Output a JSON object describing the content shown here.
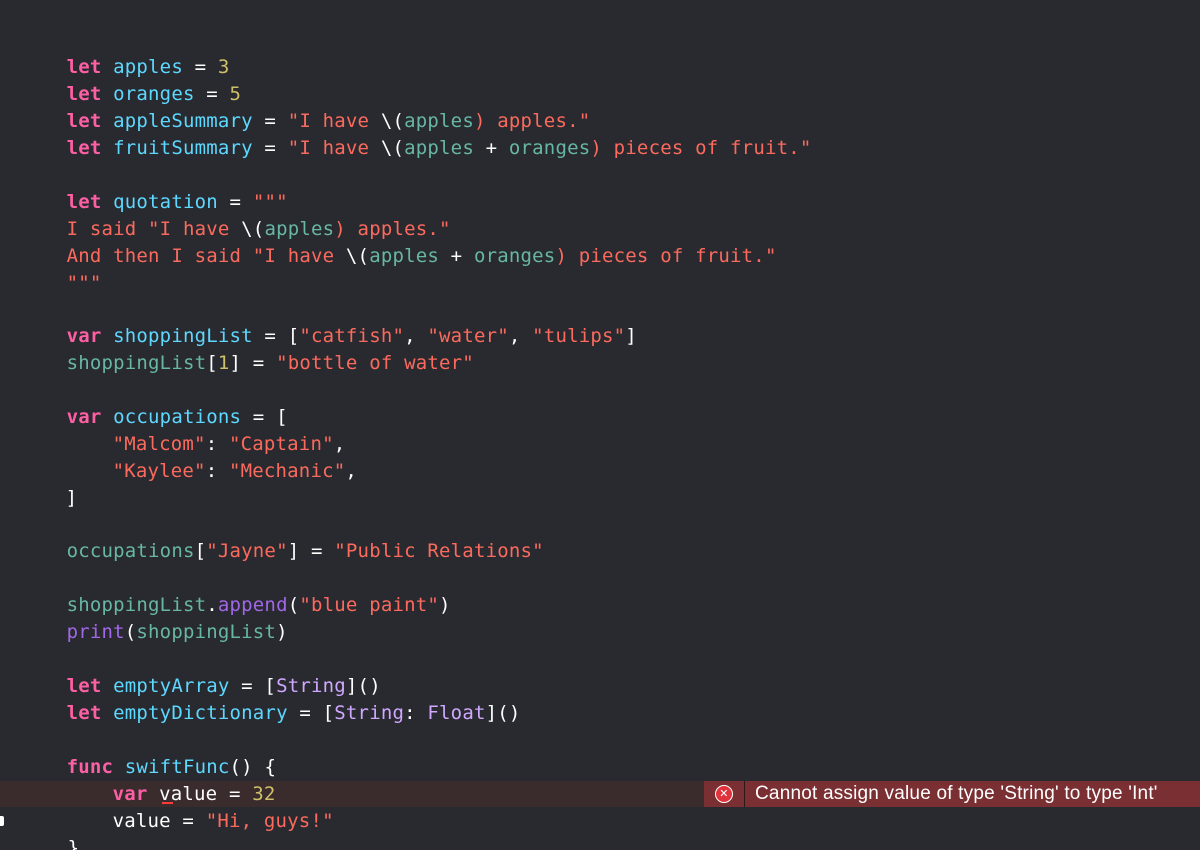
{
  "editor": {
    "lines": {
      "l1": [
        "let",
        "apples",
        " = ",
        "3"
      ],
      "l2": [
        "let",
        "oranges",
        " = ",
        "5"
      ],
      "l3": [
        "let",
        "appleSummary",
        " = ",
        "\"I have ",
        "\\(",
        "apples",
        ") apples.\""
      ],
      "l4": [
        "let",
        "fruitSummary",
        " = ",
        "\"I have ",
        "\\(",
        "apples",
        " + ",
        "oranges",
        ") pieces of fruit.\""
      ],
      "l5": [
        "let",
        "quotation",
        " = ",
        "\"\"\""
      ],
      "l6": [
        "I said \"I have ",
        "\\(",
        "apples",
        ") apples.\""
      ],
      "l7": [
        "And then I said \"I have ",
        "\\(",
        "apples",
        " + ",
        "oranges",
        ") pieces of fruit.\""
      ],
      "l8": [
        "\"\"\""
      ],
      "l9": [
        "var",
        "shoppingList",
        " = [",
        "\"catfish\"",
        ", ",
        "\"water\"",
        ", ",
        "\"tulips\"",
        "]"
      ],
      "l10": [
        "shoppingList",
        "[",
        "1",
        "] = ",
        "\"bottle of water\""
      ],
      "l11": [
        "var",
        "occupations",
        " = ["
      ],
      "l12": [
        "\"Malcom\"",
        ": ",
        "\"Captain\"",
        ","
      ],
      "l13": [
        "\"Kaylee\"",
        ": ",
        "\"Mechanic\"",
        ","
      ],
      "l14": [
        "]"
      ],
      "l15": [
        "occupations",
        "[",
        "\"Jayne\"",
        "] = ",
        "\"Public Relations\""
      ],
      "l16": [
        "shoppingList",
        ".",
        "append",
        "(",
        "\"blue paint\"",
        ")"
      ],
      "l17": [
        "print",
        "(",
        "shoppingList",
        ")"
      ],
      "l18": [
        "let",
        "emptyArray",
        " = [",
        "String",
        "]()"
      ],
      "l19": [
        "let",
        "emptyDictionary",
        " = [",
        "String",
        ": ",
        "Float",
        "]()"
      ],
      "l20": [
        "func",
        "swiftFunc",
        "() {"
      ],
      "l21": [
        "var",
        "value",
        " = ",
        "32"
      ],
      "l22": [
        "value = ",
        "\"Hi, guys!\""
      ],
      "l23": [
        "}"
      ]
    }
  },
  "error": {
    "icon": "error-x-icon",
    "glyph": "✕",
    "message": "Cannot assign value of type 'String' to type 'Int'"
  },
  "colors": {
    "background": "#292a30",
    "keyword": "#fc5fa3",
    "declaration": "#5dd8ff",
    "identifier": "#67b7a4",
    "number": "#d0bf69",
    "string": "#fc6a5d",
    "function": "#a167e6",
    "error_badge": "#7a2f33"
  }
}
